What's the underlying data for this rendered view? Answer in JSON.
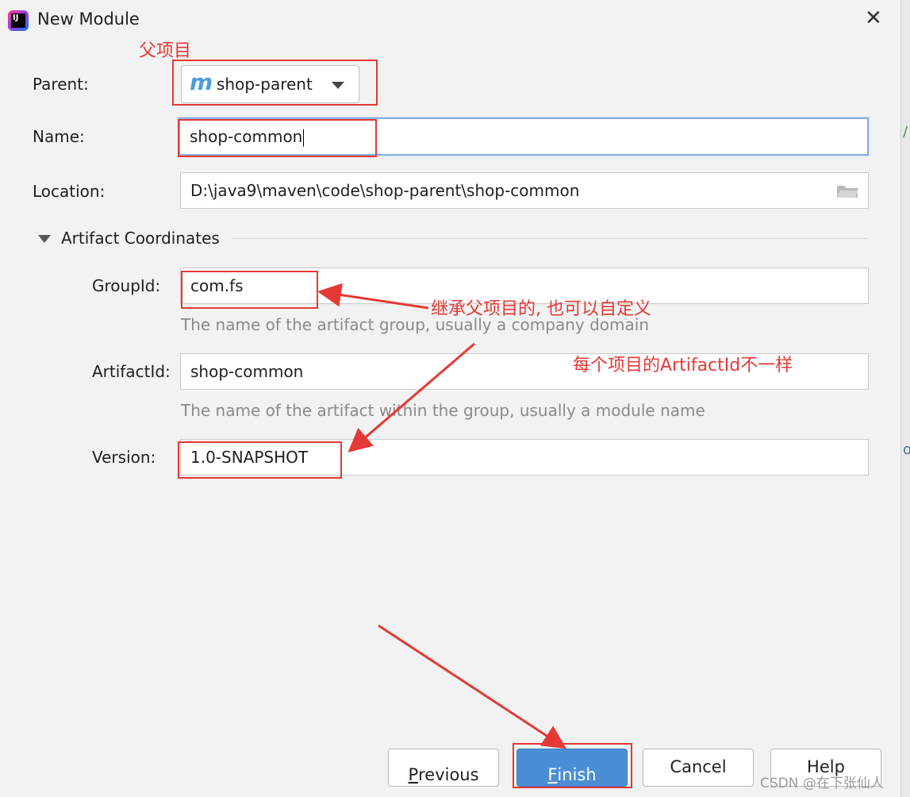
{
  "window": {
    "title": "New Module",
    "close_symbol": "✕"
  },
  "form": {
    "parent": {
      "label": "Parent:",
      "value": "shop-parent",
      "icon_glyph": "m"
    },
    "name": {
      "label": "Name:",
      "value": "shop-common"
    },
    "location": {
      "label": "Location:",
      "value": "D:\\java9\\maven\\code\\shop-parent\\shop-common"
    },
    "section": {
      "title": "Artifact Coordinates"
    },
    "group_id": {
      "label": "GroupId:",
      "value": "com.fs",
      "hint": "The name of the artifact group, usually a company domain"
    },
    "artifact_id": {
      "label": "ArtifactId:",
      "value": "shop-common",
      "hint": "The name of the artifact within the group, usually a module name"
    },
    "version": {
      "label": "Version:",
      "value": "1.0-SNAPSHOT"
    }
  },
  "buttons": {
    "previous": {
      "mnemonic": "P",
      "rest": "revious"
    },
    "finish": {
      "mnemonic": "F",
      "rest": "inish"
    },
    "cancel": "Cancel",
    "help": "Help"
  },
  "annotations": {
    "parent_note": "父项目",
    "groupid_note": "继承父项目的, 也可以自定义",
    "artifactid_note": "每个项目的ArtifactId不一样",
    "color": "#e53935"
  },
  "watermark": "CSDN @在下张仙人",
  "icons": [
    "intellij-icon",
    "close-icon",
    "maven-icon",
    "dropdown-arrow-icon",
    "folder-icon",
    "collapse-triangle-icon"
  ]
}
